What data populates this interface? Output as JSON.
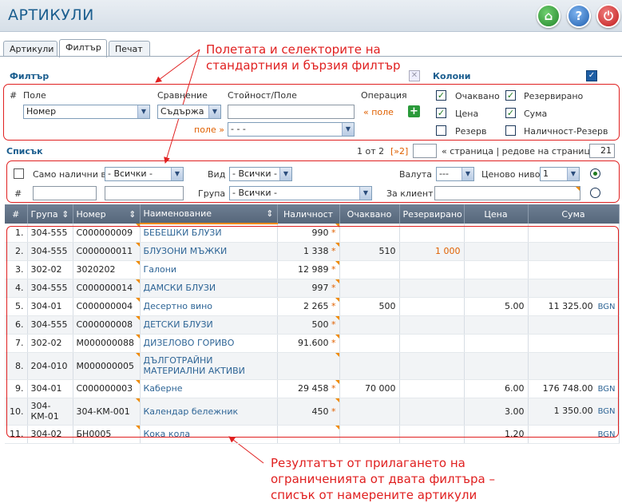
{
  "header": {
    "title": "АРТИКУЛИ",
    "buttons": [
      "home-icon",
      "help-icon",
      "power-icon"
    ]
  },
  "tabs": [
    {
      "label": "Артикули",
      "active": false
    },
    {
      "label": "Филтър",
      "active": true
    },
    {
      "label": "Печат",
      "active": false
    }
  ],
  "filter": {
    "title": "Филтър",
    "col_num": "#",
    "field_label": "Поле",
    "compare_label": "Сравнение",
    "value_label": "Стойност/Поле",
    "op_label": "Операция",
    "field_value": "Номер",
    "compare_value": "Съдържа",
    "value_input": "",
    "op_link": "« поле",
    "field2_label": "поле »",
    "field2_value": "- - -"
  },
  "columns": {
    "title": "Колони",
    "items": [
      {
        "label": "Очаквано",
        "checked": true
      },
      {
        "label": "Резервирано",
        "checked": true
      },
      {
        "label": "Цена",
        "checked": true
      },
      {
        "label": "Сума",
        "checked": true
      },
      {
        "label": "Резерв",
        "checked": false
      },
      {
        "label": "Наличност-Резерв",
        "checked": false
      }
    ]
  },
  "list": {
    "title": "Списък",
    "page_info": "1 от 2",
    "next_page": "[»2]",
    "page_link": "« страница | редове на страница »",
    "rows_per_page": "21"
  },
  "quick": {
    "only_available": "Само налични в",
    "all": "- Всички -",
    "kind_label": "Вид",
    "currency_label": "Валута",
    "currency_value": "---",
    "price_level_label": "Ценово ниво",
    "price_level_value": "1",
    "num_label": "#",
    "group_label": "Група",
    "client_label": "За клиент"
  },
  "grid": {
    "headers": [
      "#",
      "Група",
      "Номер",
      "Наименование",
      "Наличност",
      "Очаквано",
      "Резервирано",
      "Цена",
      "Сума"
    ],
    "rows": [
      {
        "n": "1.",
        "group": "304-555",
        "code": "C000000009",
        "name": "БЕБЕШКИ БЛУЗИ",
        "qty": "990",
        "exp": "",
        "res": "",
        "price": "",
        "sum": "",
        "cur": ""
      },
      {
        "n": "2.",
        "group": "304-555",
        "code": "C000000011",
        "name": "БЛУЗОНИ МЪЖКИ",
        "qty": "1 338",
        "exp": "510",
        "res": "1 000",
        "price": "",
        "sum": "",
        "cur": ""
      },
      {
        "n": "3.",
        "group": "302-02",
        "code": "3020202",
        "name": "Галони",
        "qty": "12 989",
        "exp": "",
        "res": "",
        "price": "",
        "sum": "",
        "cur": ""
      },
      {
        "n": "4.",
        "group": "304-555",
        "code": "C000000014",
        "name": "ДАМСКИ БЛУЗИ",
        "qty": "997",
        "exp": "",
        "res": "",
        "price": "",
        "sum": "",
        "cur": ""
      },
      {
        "n": "5.",
        "group": "304-01",
        "code": "C000000004",
        "name": "Десертно вино",
        "qty": "2 265",
        "exp": "500",
        "res": "",
        "price": "5.00",
        "sum": "11 325.00",
        "cur": "BGN"
      },
      {
        "n": "6.",
        "group": "304-555",
        "code": "C000000008",
        "name": "ДЕТСКИ БЛУЗИ",
        "qty": "500",
        "exp": "",
        "res": "",
        "price": "",
        "sum": "",
        "cur": ""
      },
      {
        "n": "7.",
        "group": "302-02",
        "code": "M000000088",
        "name": "ДИЗЕЛОВО ГОРИВО",
        "qty": "91.600",
        "exp": "",
        "res": "",
        "price": "",
        "sum": "",
        "cur": ""
      },
      {
        "n": "8.",
        "group": "204-010",
        "code": "M000000005",
        "name": "ДЪЛГОТРАЙНИ МАТЕРИАЛНИ АКТИВИ",
        "qty": "",
        "exp": "",
        "res": "",
        "price": "",
        "sum": "",
        "cur": ""
      },
      {
        "n": "9.",
        "group": "304-01",
        "code": "C000000003",
        "name": "Каберне",
        "qty": "29 458",
        "exp": "70 000",
        "res": "",
        "price": "6.00",
        "sum": "176 748.00",
        "cur": "BGN"
      },
      {
        "n": "10.",
        "group": "304-КМ-01",
        "code": "304-КМ-001",
        "name": "Календар бележник",
        "qty": "450",
        "exp": "",
        "res": "",
        "price": "3.00",
        "sum": "1 350.00",
        "cur": "BGN"
      },
      {
        "n": "11.",
        "group": "304-02",
        "code": "БН0005",
        "name": "Кока кола",
        "qty": "",
        "exp": "",
        "res": "",
        "price": "1.20",
        "sum": "",
        "cur": "BGN"
      }
    ]
  },
  "annotations": {
    "top": "Полетата и селекторите на стандартния и бързия филтър",
    "bottom": "Резултатът от прилагането на ограниченията от двата филтъра – списък от намерените артикули"
  }
}
